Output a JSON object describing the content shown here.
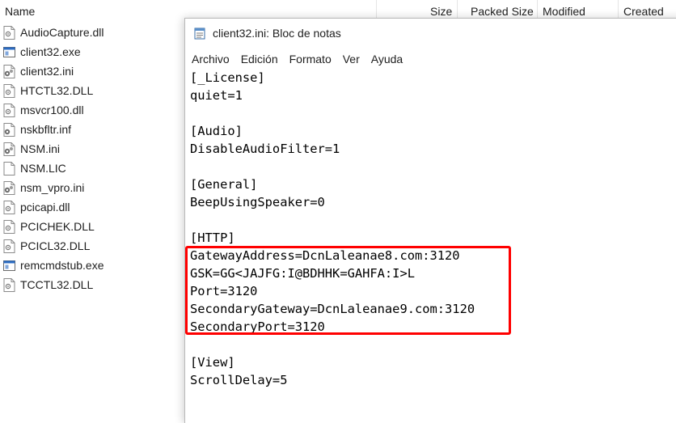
{
  "explorer": {
    "columns": {
      "name": "Name",
      "size": "Size",
      "packed_size": "Packed Size",
      "modified": "Modified",
      "created": "Created"
    },
    "files": [
      {
        "name": "AudioCapture.dll",
        "icon": "dll-file-icon"
      },
      {
        "name": "client32.exe",
        "icon": "exe-file-icon"
      },
      {
        "name": "client32.ini",
        "icon": "ini-file-icon"
      },
      {
        "name": "HTCTL32.DLL",
        "icon": "dll-file-icon"
      },
      {
        "name": "msvcr100.dll",
        "icon": "dll-file-icon"
      },
      {
        "name": "nskbfltr.inf",
        "icon": "inf-file-icon"
      },
      {
        "name": "NSM.ini",
        "icon": "ini-file-icon"
      },
      {
        "name": "NSM.LIC",
        "icon": "blank-file-icon"
      },
      {
        "name": "nsm_vpro.ini",
        "icon": "ini-file-icon"
      },
      {
        "name": "pcicapi.dll",
        "icon": "dll-file-icon"
      },
      {
        "name": "PCICHEK.DLL",
        "icon": "dll-file-icon"
      },
      {
        "name": "PCICL32.DLL",
        "icon": "dll-file-icon"
      },
      {
        "name": "remcmdstub.exe",
        "icon": "exe-file-icon"
      },
      {
        "name": "TCCTL32.DLL",
        "icon": "dll-file-icon"
      }
    ]
  },
  "notepad": {
    "title": "client32.ini: Bloc de notas",
    "icon": "notepad-icon",
    "menu": [
      "Archivo",
      "Edición",
      "Formato",
      "Ver",
      "Ayuda"
    ],
    "lines": [
      "[_License]",
      "quiet=1",
      "",
      "[Audio]",
      "DisableAudioFilter=1",
      "",
      "[General]",
      "BeepUsingSpeaker=0",
      "",
      "[HTTP]",
      "GatewayAddress=DcnLaleanae8.com:3120",
      "GSK=GG<JAJFG:I@BDHHK=GAHFA:I>L",
      "Port=3120",
      "SecondaryGateway=DcnLaleanae9.com:3120",
      "SecondaryPort=3120",
      "",
      "[View]",
      "ScrollDelay=5"
    ]
  },
  "colors": {
    "highlight": "#ff0000",
    "text": "#000000",
    "header_text": "#1e1e1e"
  }
}
